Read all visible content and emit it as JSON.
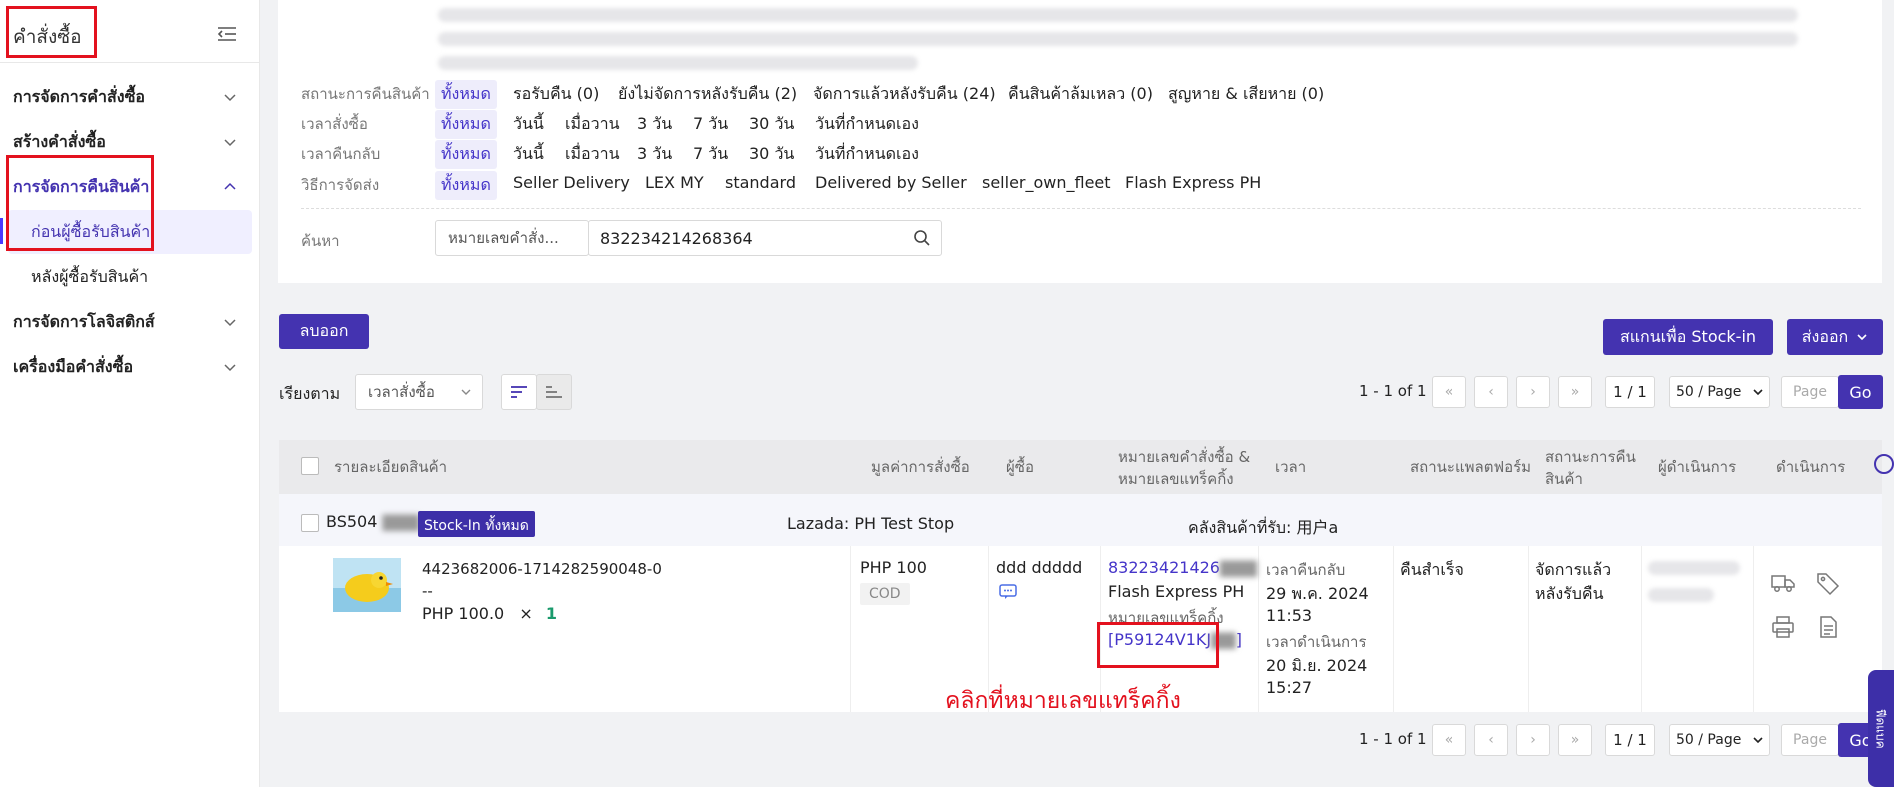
{
  "sidebar": {
    "title": "คำสั่งซื้อ",
    "menus": [
      {
        "label": "การจัดการคำสั่งซื้อ"
      },
      {
        "label": "สร้างคำสั่งซื้อ"
      },
      {
        "label": "การจัดการคืนสินค้า"
      },
      {
        "label": "การจัดการโลจิสติกส์"
      },
      {
        "label": "เครื่องมือคำสั่งซื้อ"
      }
    ],
    "subitems": [
      {
        "label": "ก่อนผู้ซื้อรับสินค้า"
      },
      {
        "label": "หลังผู้ซื้อรับสินค้า"
      }
    ]
  },
  "filters": {
    "return_status": {
      "label": "สถานะการคืนสินค้า",
      "options": [
        "ทั้งหมด",
        "รอรับคืน (0)",
        "ยังไม่จัดการหลังรับคืน (2)",
        "จัดการแล้วหลังรับคืน (24)",
        "คืนสินค้าล้มเหลว (0)",
        "สูญหาย & เสียหาย (0)"
      ]
    },
    "order_time": {
      "label": "เวลาสั่งซื้อ",
      "options": [
        "ทั้งหมด",
        "วันนี้",
        "เมื่อวาน",
        "3 วัน",
        "7 วัน",
        "30 วัน",
        "วันที่กำหนดเอง"
      ]
    },
    "return_time": {
      "label": "เวลาคืนกลับ",
      "options": [
        "ทั้งหมด",
        "วันนี้",
        "เมื่อวาน",
        "3 วัน",
        "7 วัน",
        "30 วัน",
        "วันที่กำหนดเอง"
      ]
    },
    "shipping": {
      "label": "วิธีการจัดส่ง",
      "options": [
        "ทั้งหมด",
        "Seller Delivery",
        "LEX MY",
        "standard",
        "Delivered by Seller",
        "seller_own_fleet",
        "Flash Express PH"
      ]
    },
    "search": {
      "label": "ค้นหา",
      "type_value": "หมายเลขคำสั่ง...",
      "value": "832234214268364"
    }
  },
  "toolbar": {
    "delete_label": "ลบออก",
    "scan_label": "สแกนเพื่อ Stock-in",
    "export_label": "ส่งออก",
    "sort_label": "เรียงตาม",
    "sort_value": "เวลาสั่งซื้อ"
  },
  "pagination": {
    "range": "1 - 1 of 1",
    "page": "1 / 1",
    "page_size": "50 / Page",
    "page_placeholder": "Page",
    "go": "Go"
  },
  "table": {
    "headers": [
      "รายละเอียดสินค้า",
      "มูลค่าการสั่งซื้อ",
      "ผู้ซื้อ",
      "หมายเลขคำสั่งซื้อ &\nหมายเลขแทร็คกิ้ง",
      "เวลา",
      "สถานะแพลตฟอร์ม",
      "สถานะการคืน\nสินค้า",
      "ผู้ดำเนินการ",
      "ดำเนินการ"
    ],
    "group": {
      "id": "BS504",
      "badge": "Stock-In ทั้งหมด",
      "store": "Lazada: PH Test Stop",
      "warehouse": "คลังสินค้าที่รับ: 用户a"
    },
    "row": {
      "sku": "4423682006-1714282590048-0",
      "variant": "--",
      "price": "PHP 100.0",
      "times": "×",
      "qty": "1",
      "order_value": "PHP 100",
      "payment": "COD",
      "buyer": "ddd ddddd",
      "order_no": "83223421426",
      "carrier": "Flash Express PH",
      "tracking_label": "หมายเลขแทร็คกิ้ง",
      "tracking_no": "[P59124V1KJ",
      "tracking_close": "]",
      "return_time_label": "เวลาคืนกลับ",
      "return_date": "29 พ.ค. 2024",
      "return_clock": "11:53",
      "process_time_label": "เวลาดำเนินการ",
      "process_date": "20 มิ.ย. 2024",
      "process_clock": "15:27",
      "platform_status": "คืนสำเร็จ",
      "return_status": "จัดการแล้ว\nหลังรับคืน"
    }
  },
  "annotation": {
    "text": "คลิกที่หมายเลขแทร็คกิ้ง",
    "color": "#e3111e"
  },
  "feedback_tab": "ฟีดแบค",
  "accent": "#4433b0"
}
